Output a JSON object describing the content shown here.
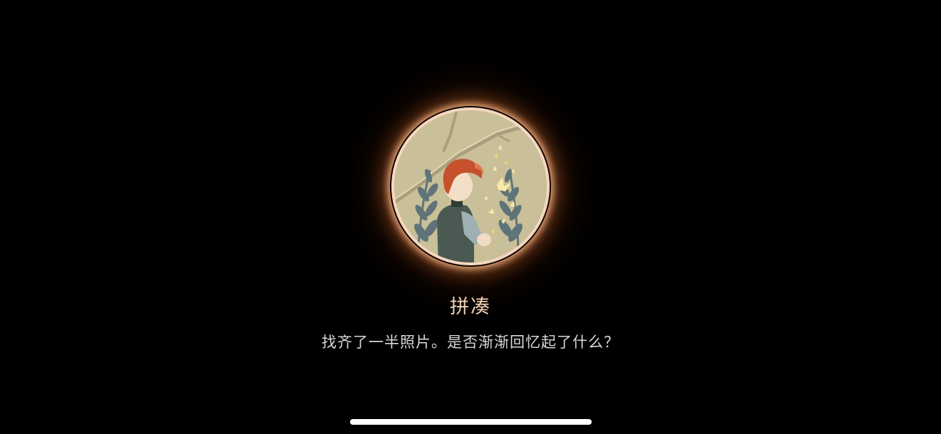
{
  "achievement": {
    "icon": "boy-with-butterflies-icon",
    "title": "拼凑",
    "description": "找齐了一半照片。是否渐渐回忆起了什么？"
  },
  "colors": {
    "background": "#000000",
    "ring": "#f6d6bd",
    "title": "#f2d3b6",
    "description": "#d8d8d8",
    "home_indicator": "#ffffff"
  }
}
